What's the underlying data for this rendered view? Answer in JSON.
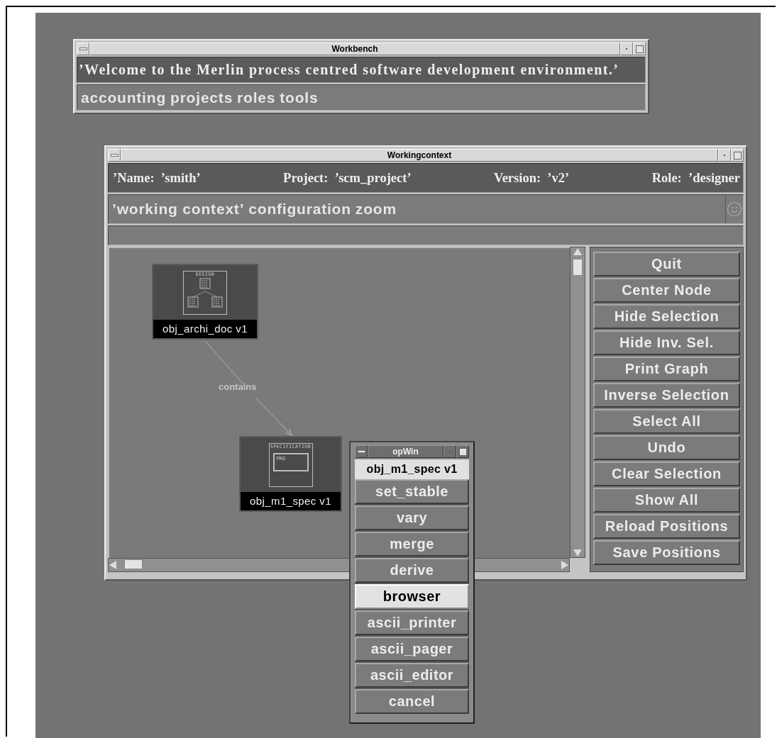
{
  "workbench": {
    "title": "Workbench",
    "message": "’Welcome to the Merlin process centred software development environment.’",
    "menu": [
      "accounting",
      "projects",
      "roles",
      "tools"
    ]
  },
  "working_context": {
    "title": "Workingcontext",
    "info": [
      "’Name:  ’smith’",
      "Project:  ’scm_project’",
      "Version:  ’v2’",
      "Role:  ’designer"
    ],
    "menu": [
      "’working context’",
      "configuration",
      "zoom"
    ],
    "graph": {
      "nodes": [
        {
          "label": "obj_archi_doc v1",
          "kind": "design",
          "icon_title": "DESIGN"
        },
        {
          "label": "obj_m1_spec v1",
          "kind": "specification",
          "icon_title": "SPECIFICATION",
          "icon_tag": "PRO"
        }
      ],
      "edges": [
        {
          "label": "contains"
        }
      ]
    },
    "buttons": [
      "Quit",
      "Center Node",
      "Hide Selection",
      "Hide Inv. Sel.",
      "Print Graph",
      "Inverse Selection",
      "Select All",
      "Undo",
      "Clear Selection",
      "Show All",
      "Reload Positions",
      "Save Positions"
    ]
  },
  "opwin": {
    "title": "opWin",
    "object": "obj_m1_spec v1",
    "operations": [
      {
        "label": "set_stable",
        "selected": false
      },
      {
        "label": "vary",
        "selected": false
      },
      {
        "label": "merge",
        "selected": false
      },
      {
        "label": "derive",
        "selected": false
      },
      {
        "label": "browser",
        "selected": true
      },
      {
        "label": "ascii_printer",
        "selected": false
      },
      {
        "label": "ascii_pager",
        "selected": false
      },
      {
        "label": "ascii_editor",
        "selected": false
      },
      {
        "label": "cancel",
        "selected": false
      }
    ]
  }
}
